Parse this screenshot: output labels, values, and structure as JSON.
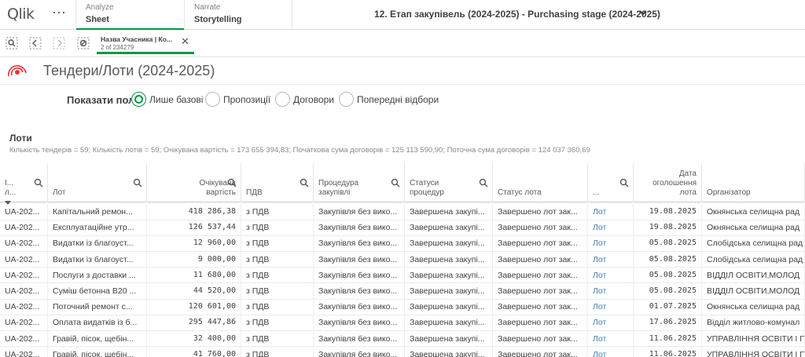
{
  "app": {
    "logo_text": "Qlik",
    "menu_icon": "more-dots-icon"
  },
  "tabs": [
    {
      "sub": "Analyze",
      "main": "Sheet"
    },
    {
      "sub": "Narrate",
      "main": "Storytelling"
    }
  ],
  "sheet_selector": {
    "title": "12. Етап закупівель (2024-2025) - Purchasing stage (2024-2025)"
  },
  "selection_chip": {
    "name": "Назва Учасника | Ко...",
    "count": "2 of 234279"
  },
  "page": {
    "title": "Тендери/Лоти (2024-2025)"
  },
  "show_fields": {
    "label": "Показати поля:",
    "options": [
      {
        "label": "Лише базові",
        "checked": true
      },
      {
        "label": "Пропозиції",
        "checked": false
      },
      {
        "label": "Договори",
        "checked": false
      },
      {
        "label": "Попередні відбори",
        "checked": false
      }
    ]
  },
  "lots": {
    "title": "Лоти",
    "summary": "Кількість тендерів = 59; Кількість лотів = 59; Очікувана вартість = 173 655 394,83; Початкова сума договорів = 125 113 590,90; Поточна сума договорів = 124 037 360,69"
  },
  "table": {
    "headers": [
      {
        "line1": "І...",
        "line2": "л..."
      },
      {
        "line1": "",
        "line2": "Лот"
      },
      {
        "line1": "Очікувана",
        "line2": "вартість"
      },
      {
        "line1": "",
        "line2": "ПДВ"
      },
      {
        "line1": "Процедура",
        "line2": "закупівлі"
      },
      {
        "line1": "Статуси",
        "line2": "процедур"
      },
      {
        "line1": "",
        "line2": "Статус лота"
      },
      {
        "line1": "",
        "line2": "..."
      },
      {
        "line0": "Дата",
        "line1": "оголошення",
        "line2": "лота"
      },
      {
        "line1": "",
        "line2": "Організатор"
      }
    ],
    "rows": [
      [
        "UA-202...",
        "Капітальний ремон...",
        "418 286,38",
        "з ПДВ",
        "Закупівля без вико...",
        "Завершена закупі...",
        "Завершено лот зак...",
        "Лот",
        "19.08.2025",
        "Окнянська селищна рад"
      ],
      [
        "UA-202...",
        "Експлуатаційне утр...",
        "126 537,44",
        "з ПДВ",
        "Закупівля без вико...",
        "Завершена закупі...",
        "Завершено лот зак...",
        "Лот",
        "19.08.2025",
        "Окнянська селищна рад"
      ],
      [
        "UA-202...",
        "Видатки із благоуст...",
        "12 960,00",
        "з ПДВ",
        "Закупівля без вико...",
        "Завершена закупі...",
        "Завершено лот зак...",
        "Лот",
        "05.08.2025",
        "Слобідська селищна рад"
      ],
      [
        "UA-202...",
        "Видатки із благоуст...",
        "9 000,00",
        "з ПДВ",
        "Закупівля без вико...",
        "Завершена закупі...",
        "Завершено лот зак...",
        "Лот",
        "05.08.2025",
        "Слобідська селищна рад"
      ],
      [
        "UA-202...",
        "Послуги з доставки ...",
        "11 680,00",
        "з ПДВ",
        "Закупівля без вико...",
        "Завершена закупі...",
        "Завершено лот зак...",
        "Лот",
        "05.08.2025",
        "ВІДДІЛ ОСВІТИ,МОЛОД"
      ],
      [
        "UA-202...",
        "Суміш бетонна В20 ...",
        "44 520,00",
        "з ПДВ",
        "Закупівля без вико...",
        "Завершена закупі...",
        "Завершено лот зак...",
        "Лот",
        "05.08.2025",
        "ВІДДІЛ ОСВІТИ,МОЛОД"
      ],
      [
        "UA-202...",
        "Поточний ремонт с...",
        "120 601,00",
        "з ПДВ",
        "Закупівля без вико...",
        "Завершена закупі...",
        "Завершено лот зак...",
        "Лот",
        "01.07.2025",
        "Окнянська селищна рад"
      ],
      [
        "UA-202...",
        "Оплата видатків із б...",
        "295 447,86",
        "з ПДВ",
        "Закупівля без вико...",
        "Завершена закупі...",
        "Завершено лот зак...",
        "Лот",
        "17.06.2025",
        "Відділ житлово-комунал"
      ],
      [
        "UA-202...",
        "Гравій, пісок, щебін...",
        "32 400,00",
        "з ПДВ",
        "Закупівля без вико...",
        "Завершена закупі...",
        "Завершено лот зак...",
        "Лот",
        "11.06.2025",
        "УПРАВЛІННЯ ОСВІТИ І П"
      ],
      [
        "UA-202...",
        "Гравій, пісок, щебін...",
        "41 760,00",
        "з ПДВ",
        "Закупівля без вико...",
        "Завершена закупі...",
        "Завершено лот зак...",
        "Лот",
        "11.06.2025",
        "УПРАВЛІННЯ ОСВІТИ І П"
      ]
    ]
  },
  "colors": {
    "accent": "#009845",
    "link": "#3f7fb7",
    "brand_red": "#e8333a"
  }
}
